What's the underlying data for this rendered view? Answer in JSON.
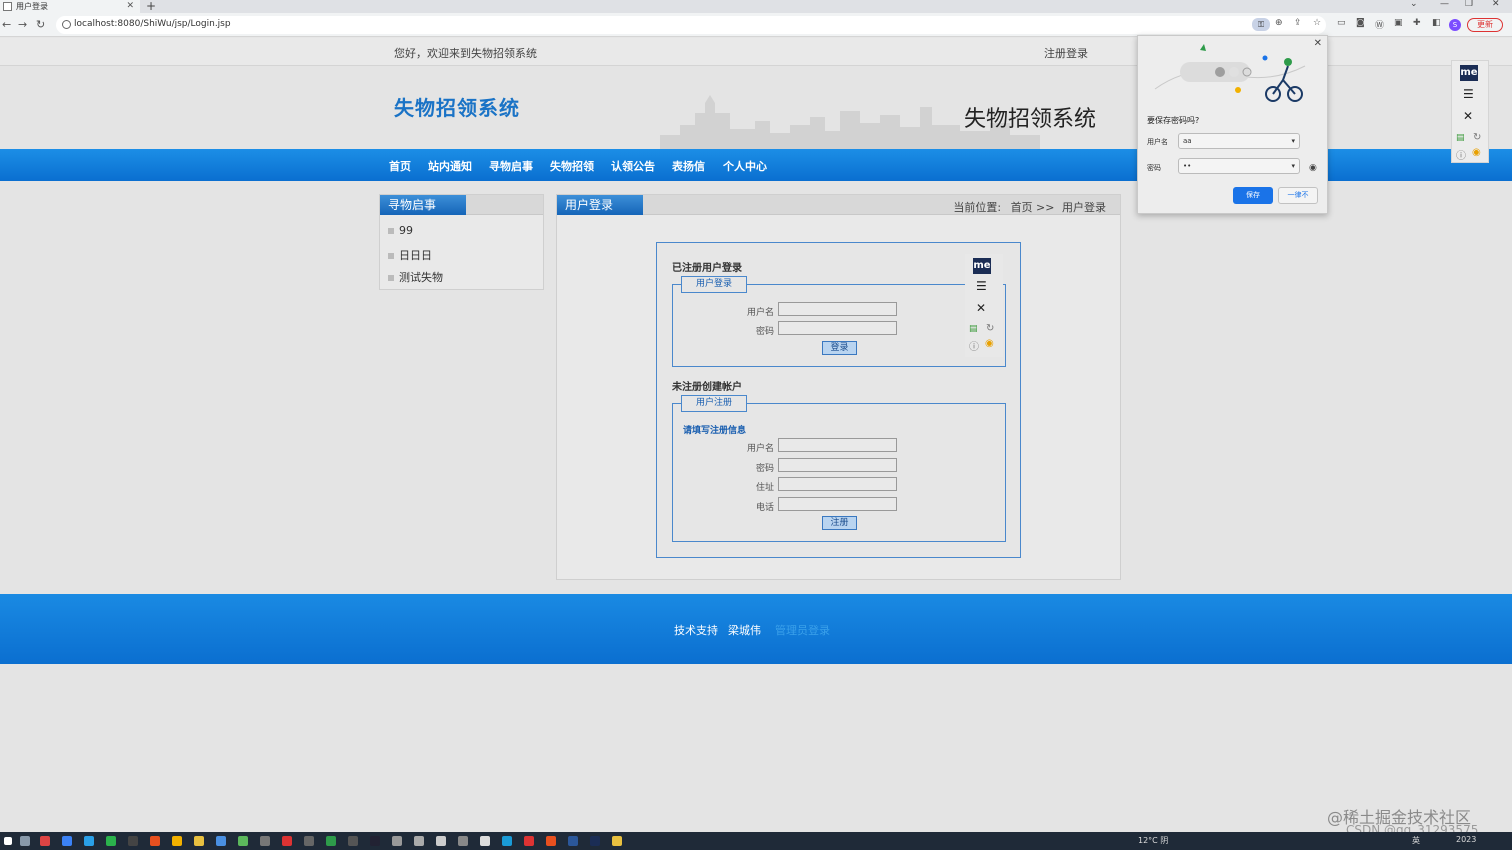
{
  "browser": {
    "tab_title": "用户登录",
    "url": "localhost:8080/ShiWu/jsp/Login.jsp",
    "update_label": "更新",
    "avatar_letter": "S"
  },
  "topbar": {
    "welcome": "您好，欢迎来到失物招领系统",
    "register_login": "注册登录"
  },
  "header": {
    "logo": "失物招领系统",
    "title": "失物招领系统"
  },
  "nav": {
    "items": [
      "首页",
      "站内通知",
      "寻物启事",
      "失物招领",
      "认领公告",
      "表扬信",
      "个人中心"
    ]
  },
  "side": {
    "title": "寻物启事",
    "items": [
      "99",
      "日日日",
      "测试失物"
    ]
  },
  "main": {
    "title": "用户登录",
    "crumb_label": "当前位置:",
    "crumb_home": "首页 >>",
    "crumb_current": "用户登录",
    "login_section": "已注册用户登录",
    "login_legend": "用户登录",
    "login_fields": [
      "用户名",
      "密码"
    ],
    "login_button": "登录",
    "register_section": "未注册创建帐户",
    "register_legend": "用户注册",
    "register_hint": "请填写注册信息",
    "register_fields": [
      "用户名",
      "密码",
      "住址",
      "电话"
    ],
    "register_button": "注册"
  },
  "footer": {
    "support": "技术支持",
    "author": "梁城伟",
    "admin_login": "管理员登录"
  },
  "password_popup": {
    "question": "要保存密码吗?",
    "username_label": "用户名",
    "username_value": "aa",
    "password_label": "密码",
    "password_value": "••",
    "save_button": "保存",
    "never_button": "一律不"
  },
  "me_widget": {
    "logo_text": "me"
  },
  "taskbar": {
    "weather": "12°C 阴",
    "lang": "英",
    "year": "2023"
  },
  "watermark": {
    "line1": "@稀土掘金技术社区",
    "line2": "CSDN @qq_31293575"
  }
}
